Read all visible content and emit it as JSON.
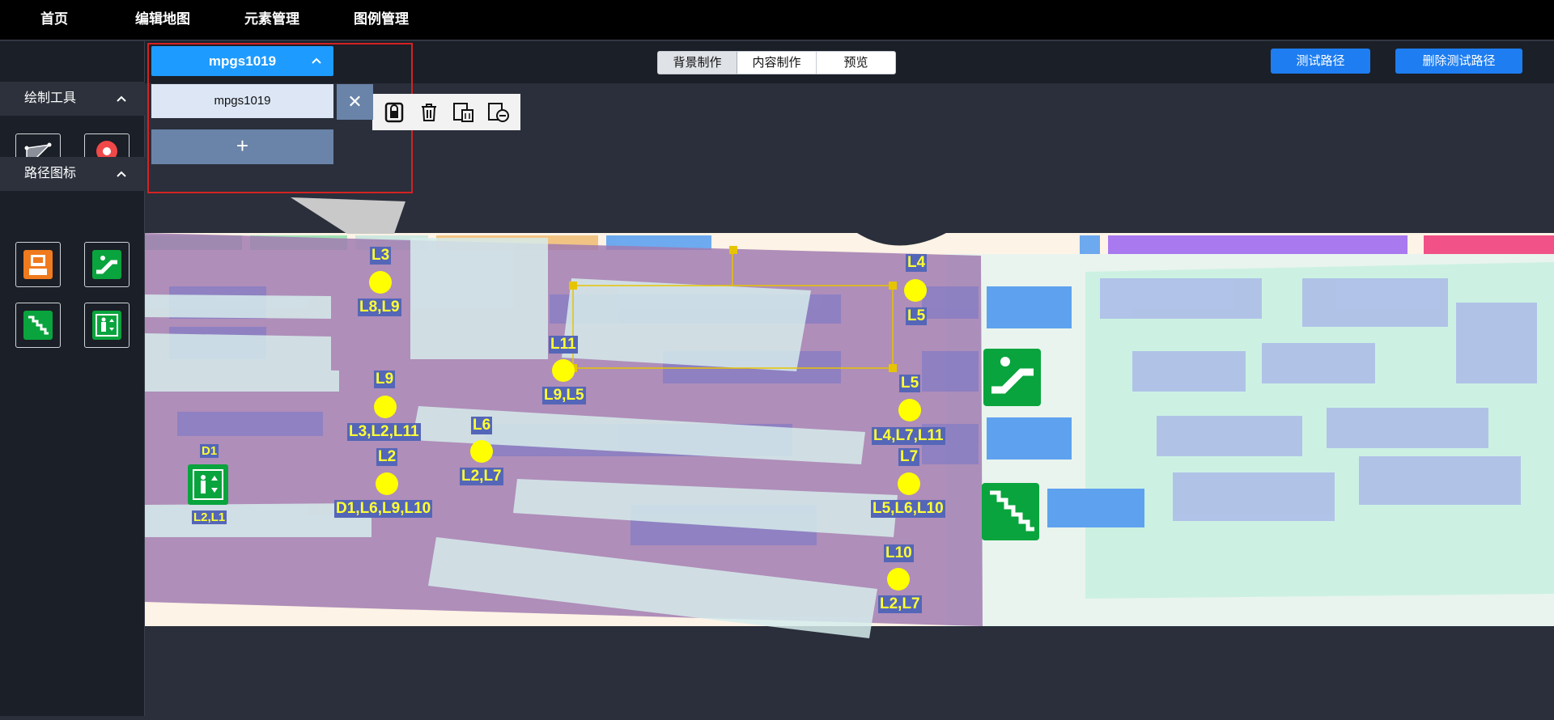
{
  "nav": {
    "items": [
      "首页",
      "编辑地图",
      "元素管理",
      "图例管理"
    ]
  },
  "sidebar": {
    "draw_tools_label": "绘制工具",
    "path_icons_label": "路径图标"
  },
  "floor": {
    "selected": "mpgs1019",
    "option": "mpgs1019",
    "close": "✕",
    "add": "+"
  },
  "modes": {
    "bg": "背景制作",
    "content": "内容制作",
    "preview": "预览"
  },
  "actions": {
    "test_path": "测试路径",
    "delete_test_path": "删除测试路径"
  },
  "map": {
    "nodes": [
      {
        "id": "L3",
        "links": "L8,L9"
      },
      {
        "id": "L4",
        "links": "L5"
      },
      {
        "id": "L11",
        "links": "L9,L5"
      },
      {
        "id": "L9",
        "links": "L3,L2,L11"
      },
      {
        "id": "L5",
        "links": "L4,L7,L11"
      },
      {
        "id": "L6",
        "links": "L2,L7"
      },
      {
        "id": "L2",
        "links": "D1,L6,L9,L10"
      },
      {
        "id": "L7",
        "links": "L5,L6,L10"
      },
      {
        "id": "L10",
        "links": "L2,L7"
      }
    ],
    "door": {
      "id": "D1",
      "links": "L2,L1"
    }
  },
  "colors": {
    "accent": "#1e7df0",
    "floor_selected": "#1e9bff",
    "node": "#ffff00",
    "label_bg": "#5466b8",
    "zone_purple": "#9b7eaa",
    "icon_green": "#09a43d",
    "icon_orange": "#f07a1e"
  }
}
